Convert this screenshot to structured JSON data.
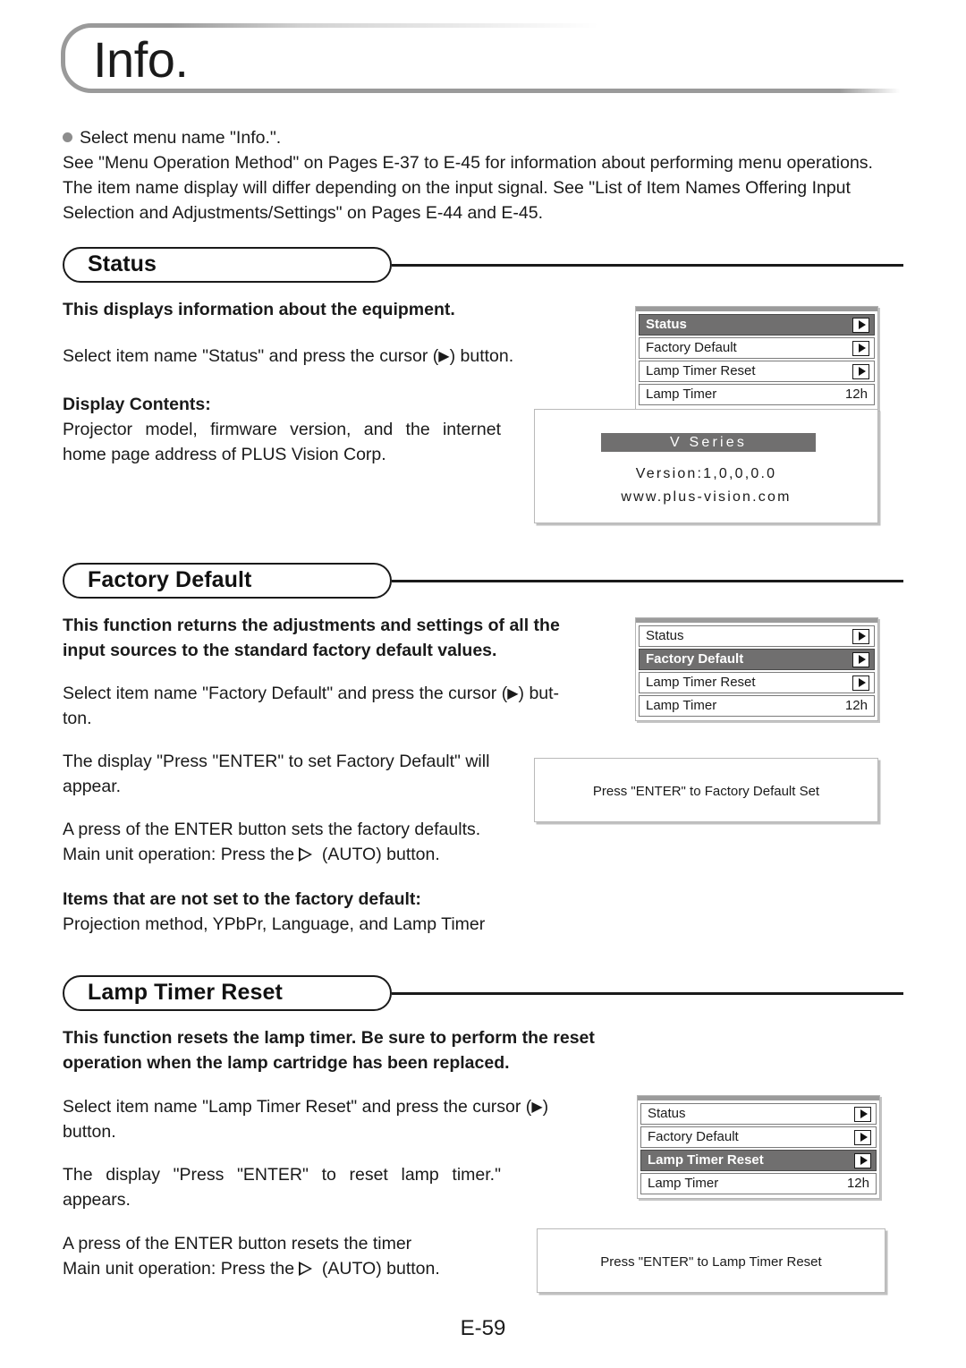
{
  "page": {
    "title": "Info.",
    "number": "E-59"
  },
  "intro": {
    "bullet_line": "Select menu name \"Info.\".",
    "line2": "See \"Menu Operation Method\" on Pages E-37 to E-45 for information about performing menu operations.",
    "line3": "The item name display will differ depending on the input signal. See \"List of Item Names Offering Input",
    "line4": "Selection and Adjustments/Settings\" on Pages E-44 and E-45."
  },
  "sections": {
    "status": {
      "heading": "Status",
      "bold_intro": "This displays information about the equipment.",
      "select_pre": "Select item name \"Status\" and press the cursor (",
      "select_post": ") button.",
      "display_contents_label": "Display Contents:",
      "display_contents_body": "Projector model, firmware version, and the internet home page address of PLUS Vision Corp."
    },
    "factory_default": {
      "heading": "Factory Default",
      "bold_intro": "This function returns the adjustments and settings of all the input sources to the standard factory default values.",
      "select_pre": "Select item name \"Factory Default\" and press the cursor (",
      "select_post": ") but-",
      "select_post2": "ton.",
      "display_para": "The display \"Press \"ENTER\" to set Factory Default\" will appear.",
      "press_line1": "A press of the ENTER button sets the factory defaults.",
      "press_line2_pre": "Main unit operation: Press the ",
      "press_line2_post": " (AUTO) button.",
      "not_reset_label": "Items that are not set to the factory default:",
      "not_reset_body": "Projection method, YPbPr, Language, and Lamp Timer"
    },
    "lamp_timer_reset": {
      "heading": "Lamp Timer Reset",
      "bold_intro": "This function resets the lamp timer. Be sure to perform the reset operation when the lamp cartridge has been replaced.",
      "select_pre": "Select item name \"Lamp Timer Reset\" and press the cursor (",
      "select_post": ")",
      "select_post2": "button.",
      "display_para": "The display \"Press \"ENTER\" to reset lamp timer.\" appears.",
      "press_line1": "A press of the ENTER button resets the timer",
      "press_line2_pre": "Main unit operation: Press the ",
      "press_line2_post": " (AUTO) button."
    }
  },
  "osd_menus": {
    "status_menu": {
      "rows": [
        {
          "label": "Status",
          "kind": "arrow",
          "selected": true
        },
        {
          "label": "Factory Default",
          "kind": "arrow",
          "selected": false
        },
        {
          "label": "Lamp Timer Reset",
          "kind": "arrow",
          "selected": false
        },
        {
          "label": "Lamp Timer",
          "kind": "value",
          "value": "12h",
          "selected": false
        }
      ]
    },
    "factory_default_menu": {
      "rows": [
        {
          "label": "Status",
          "kind": "arrow",
          "selected": false
        },
        {
          "label": "Factory Default",
          "kind": "arrow",
          "selected": true
        },
        {
          "label": "Lamp Timer Reset",
          "kind": "arrow",
          "selected": false
        },
        {
          "label": "Lamp Timer",
          "kind": "value",
          "value": "12h",
          "selected": false
        }
      ]
    },
    "lamp_timer_reset_menu": {
      "rows": [
        {
          "label": "Status",
          "kind": "arrow",
          "selected": false
        },
        {
          "label": "Factory Default",
          "kind": "arrow",
          "selected": false
        },
        {
          "label": "Lamp Timer Reset",
          "kind": "arrow",
          "selected": true
        },
        {
          "label": "Lamp Timer",
          "kind": "value",
          "value": "12h",
          "selected": false
        }
      ]
    }
  },
  "screens": {
    "version_screen": {
      "title_bar": "V Series",
      "version_line": "Version:1,0,0,0.0",
      "url_line": "www.plus-vision.com"
    },
    "factory_default_dialog": {
      "text": "Press \"ENTER\" to Factory Default Set"
    },
    "lamp_timer_reset_dialog": {
      "text": "Press \"ENTER\" to Lamp Timer Reset"
    }
  },
  "colors": {
    "osd_selected_bg": "#706f6f",
    "osd_border": "#7b7b7b",
    "text": "#1a1a1a",
    "header_frame": "#9a9a9a"
  }
}
